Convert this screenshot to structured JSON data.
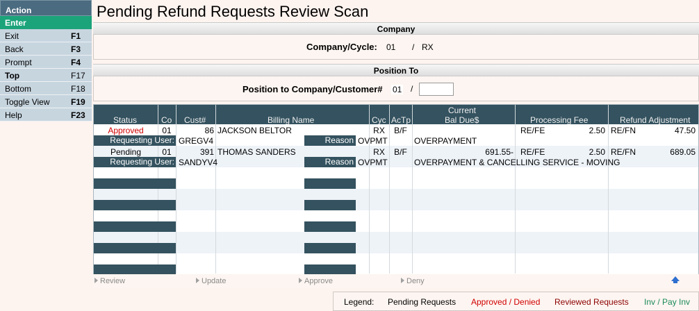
{
  "sidebar": {
    "header": "Action",
    "enter_label": "Enter",
    "items": [
      {
        "label": "Exit",
        "key": "F1",
        "bold": false
      },
      {
        "label": "Back",
        "key": "F3",
        "bold": false
      },
      {
        "label": "Prompt",
        "key": "F4",
        "bold": false
      },
      {
        "label": "Top",
        "key": "F17",
        "bold": true
      },
      {
        "label": "Bottom",
        "key": "F18",
        "bold": false
      },
      {
        "label": "Toggle View",
        "key": "F19",
        "bold": false
      },
      {
        "label": "Help",
        "key": "F23",
        "bold": false
      }
    ]
  },
  "page": {
    "title": "Pending Refund Requests Review Scan"
  },
  "company_section": {
    "header": "Company",
    "label": "Company/Cycle:",
    "company": "01",
    "separator": "/",
    "cycle": "RX"
  },
  "position_section": {
    "header": "Position To",
    "label": "Position to Company/Customer#",
    "company": "01",
    "separator": "/",
    "customer_value": ""
  },
  "grid": {
    "headers": {
      "status": "Status",
      "co": "Co",
      "cust": "Cust#",
      "billing_name": "Billing Name",
      "cyc": "Cyc",
      "actp": "AcTp",
      "current_bal_line1": "Current",
      "current_bal_line2": "Bal Due$",
      "processing_fee": "Processing Fee",
      "refund_adjustment": "Refund Adjustment"
    },
    "requesting_user_label": "Requesting User:",
    "reason_label": "Reason",
    "rows": [
      {
        "status": "Approved",
        "status_color": "#d00000",
        "co": "01",
        "cust": "86",
        "billing_name": "JACKSON BELTOR",
        "cyc": "RX",
        "actp": "B/F",
        "current_bal": "",
        "fee_code": "RE/FE",
        "fee_amount": "2.50",
        "refund_code": "RE/FN",
        "refund_amount": "47.50",
        "requesting_user": "GREGV4",
        "reason_code": "OVPMT",
        "reason_text": "OVERPAYMENT"
      },
      {
        "status": "Pending",
        "status_color": "#000000",
        "co": "01",
        "cust": "391",
        "billing_name": "THOMAS SANDERS",
        "cyc": "RX",
        "actp": "B/F",
        "current_bal": "691.55-",
        "fee_code": "RE/FE",
        "fee_amount": "2.50",
        "refund_code": "RE/FN",
        "refund_amount": "689.05",
        "requesting_user": "SANDYV4",
        "reason_code": "OVPMT",
        "reason_text": "OVERPAYMENT & CANCELLING SERVICE - MOVING"
      }
    ]
  },
  "actions": {
    "review": "Review",
    "update": "Update",
    "approve": "Approve",
    "deny": "Deny"
  },
  "legend": {
    "label": "Legend:",
    "pending": "Pending Requests",
    "approved_denied": "Approved / Denied",
    "reviewed": "Reviewed Requests",
    "inv_pay": "Inv / Pay Inv",
    "colors": {
      "pending": "#000000",
      "approved_denied": "#d00000",
      "reviewed": "#8b0000",
      "inv_pay": "#1a8a5a"
    }
  }
}
